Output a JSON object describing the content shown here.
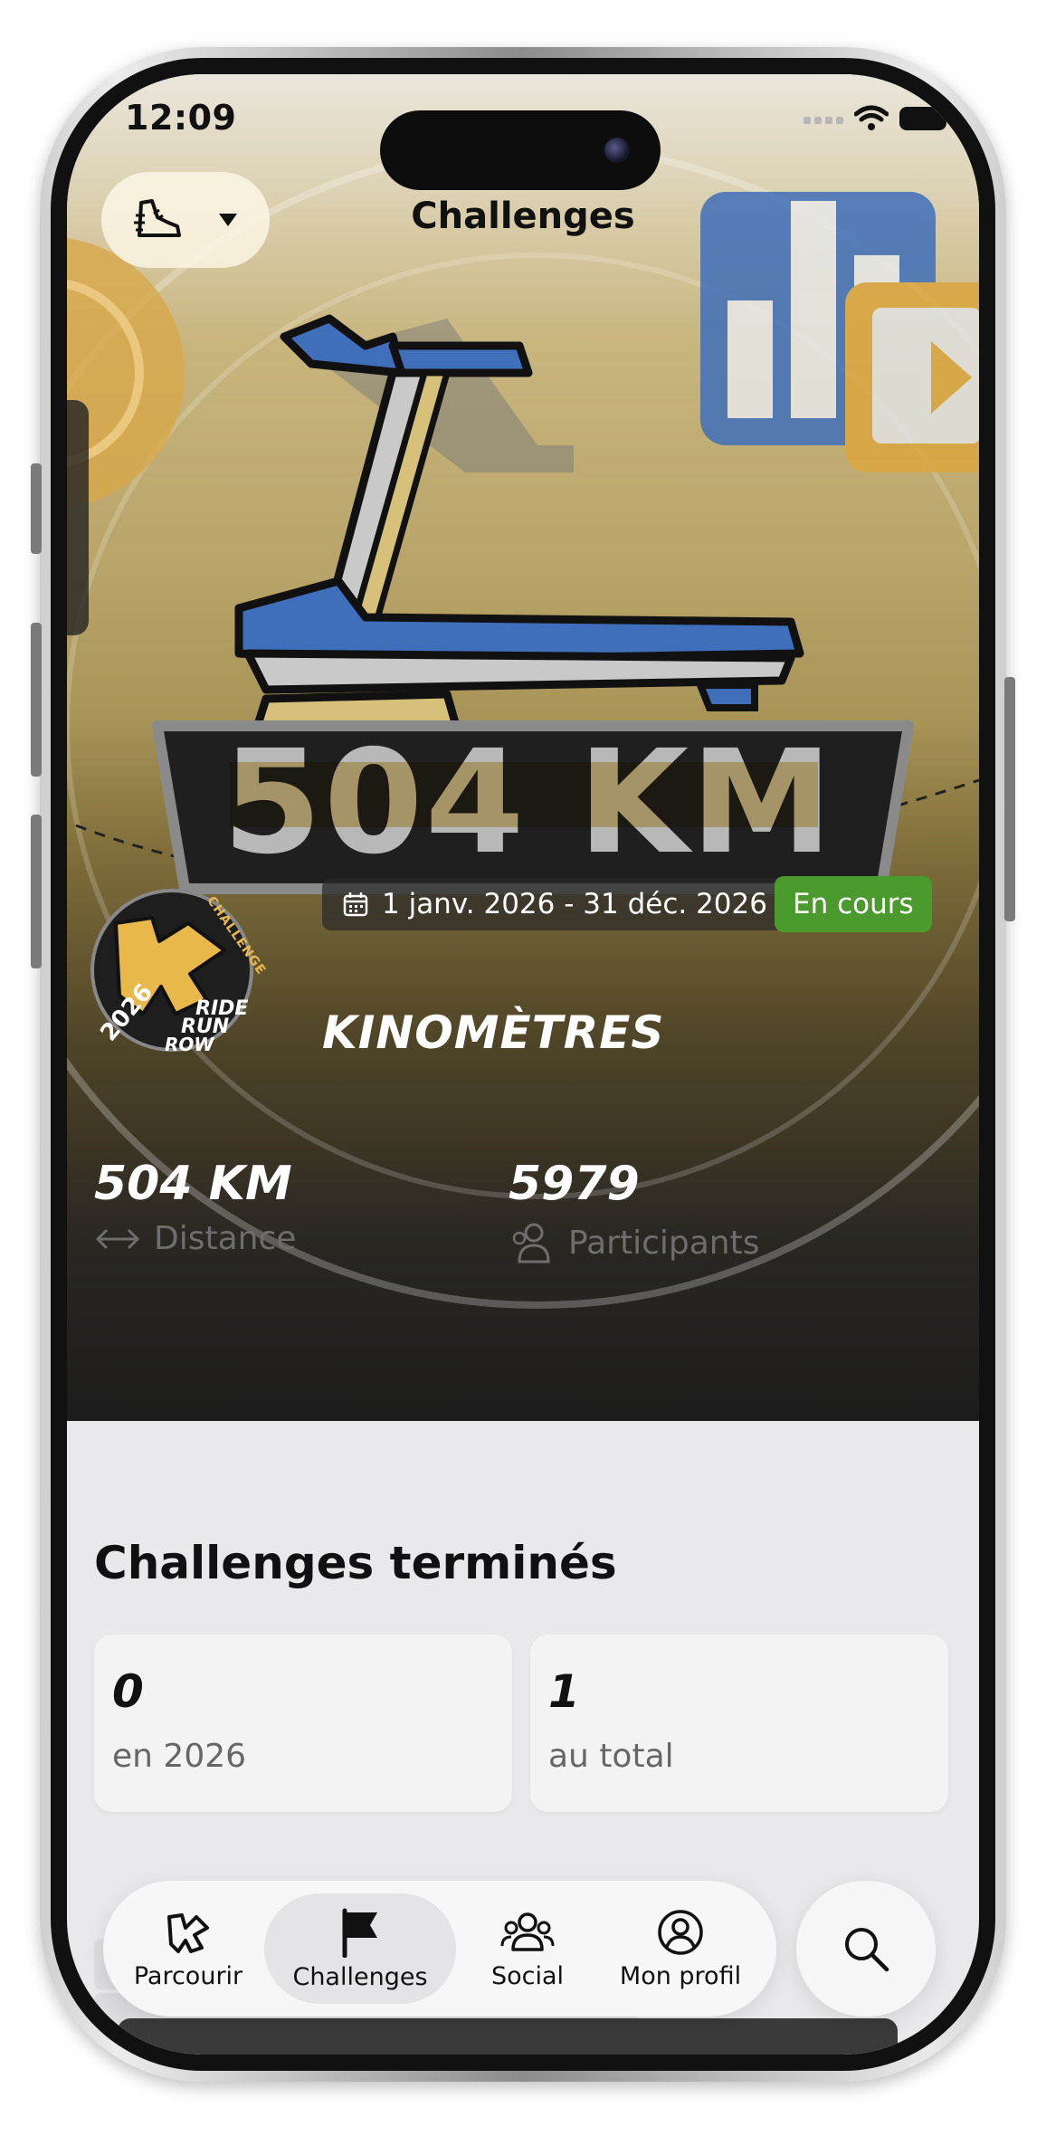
{
  "status_bar": {
    "time": "12:09"
  },
  "header": {
    "title": "Challenges",
    "sport_icon": "running-shoe-icon"
  },
  "hero": {
    "banner_text": "504 KM",
    "badge": {
      "year": "2026",
      "tag": "CHALLENGE",
      "line1": "RIDE",
      "line2": "RUN",
      "line3": "ROW"
    },
    "date_range": "1 janv. 2026 - 31 déc. 2026",
    "status": "En cours",
    "name": "KINOMÈTRES",
    "stats": [
      {
        "value": "504 KM",
        "label": "Distance",
        "icon": "arrows-horizontal-icon"
      },
      {
        "value": "5979",
        "label": "Participants",
        "icon": "people-icon"
      }
    ]
  },
  "completed": {
    "title": "Challenges terminés",
    "cards": [
      {
        "value": "0",
        "label": "en 2026"
      },
      {
        "value": "1",
        "label": "au total"
      }
    ]
  },
  "tabbar": {
    "tabs": [
      {
        "label": "Parcourir",
        "icon": "kinomap-logo-icon"
      },
      {
        "label": "Challenges",
        "icon": "flag-icon",
        "active": true
      },
      {
        "label": "Social",
        "icon": "people-icon"
      },
      {
        "label": "Mon profil",
        "icon": "profile-icon"
      }
    ],
    "search_icon": "search-icon"
  },
  "colors": {
    "accent_gold": "#e8b94a",
    "status_green": "#4a9a2e",
    "tread_blue": "#3f6fba"
  }
}
